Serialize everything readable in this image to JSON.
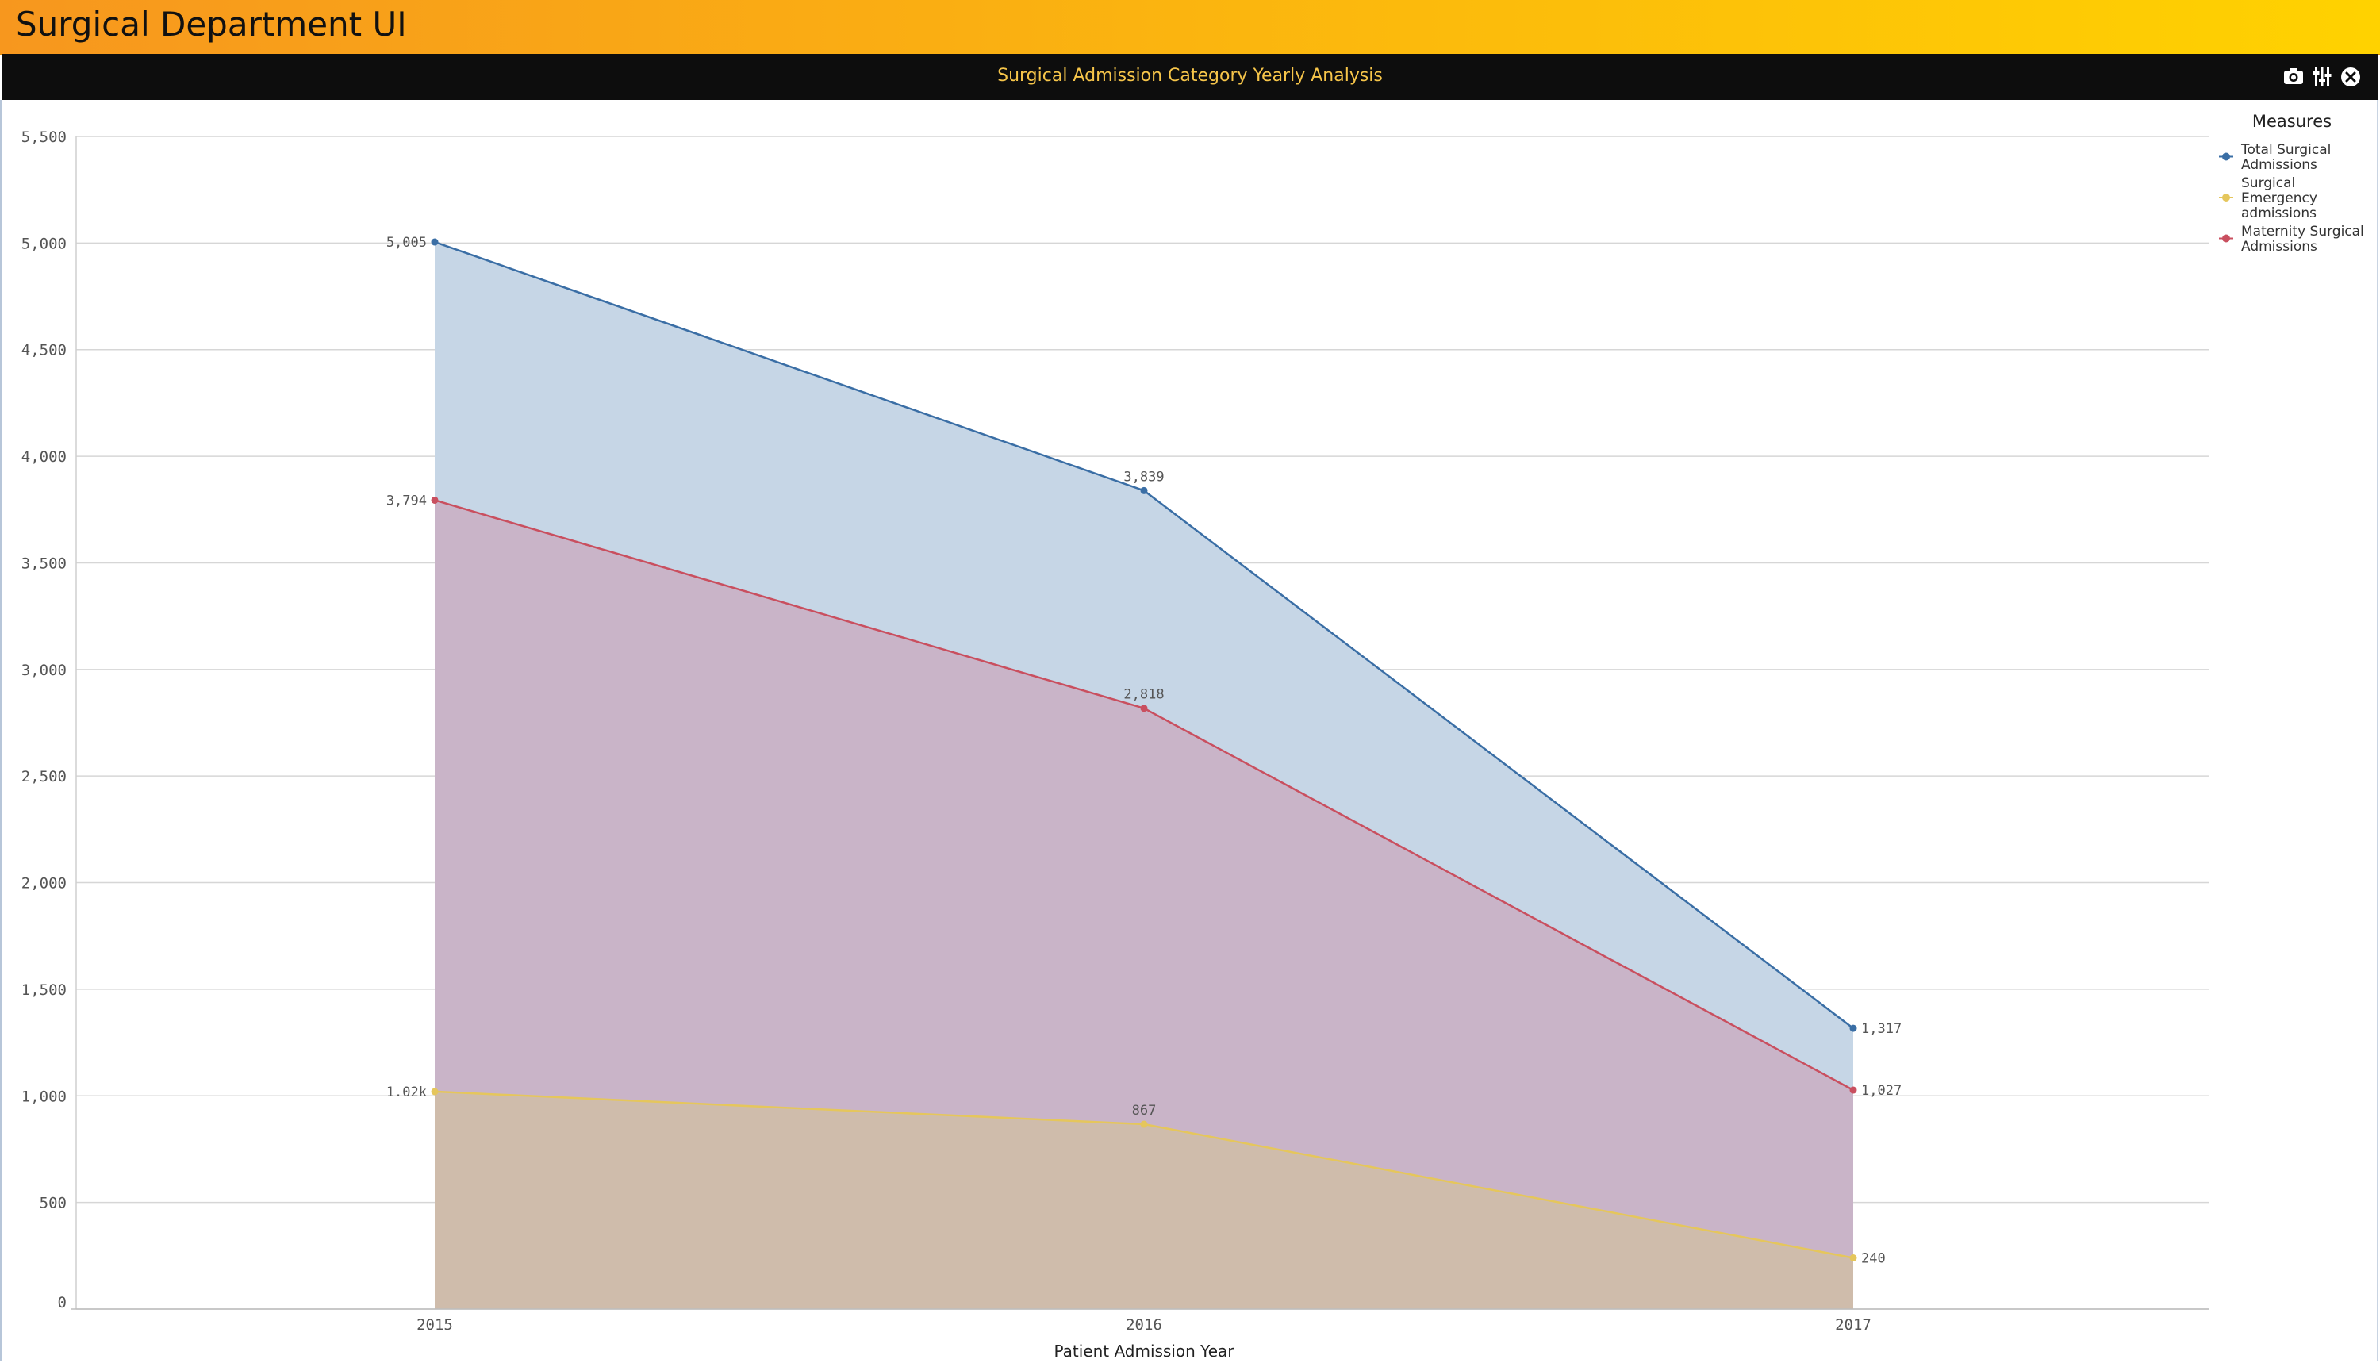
{
  "app": {
    "title": "Surgical Department UI"
  },
  "panel": {
    "title": "Surgical Admission Category Yearly Analysis",
    "icons": [
      "camera-icon",
      "settings-sliders-icon",
      "close-circle-icon"
    ]
  },
  "colors": {
    "header_gradient_start": "#f7971e",
    "header_gradient_end": "#ffd200",
    "panel_bar": "#0d0d0d",
    "panel_title": "#f6c54a"
  },
  "chart_data": {
    "type": "area",
    "x": [
      "2015",
      "2016",
      "2017"
    ],
    "xlabel": "Patient Admission Year",
    "ylabel": "",
    "ylim": [
      0,
      5500
    ],
    "yticks": [
      0,
      500,
      1000,
      1500,
      2000,
      2500,
      3000,
      3500,
      4000,
      4500,
      5000,
      5500
    ],
    "ytick_labels": [
      "0",
      "500",
      "1,000",
      "1,500",
      "2,000",
      "2,500",
      "3,000",
      "3,500",
      "4,000",
      "4,500",
      "5,000",
      "5,500"
    ],
    "grid": true,
    "legend_title": "Measures",
    "legend_position": "right",
    "series": [
      {
        "name": "Total Surgical Admissions",
        "legend_lines": [
          "Total Surgical",
          "Admissions"
        ],
        "values": [
          5005,
          3839,
          1317
        ],
        "labels": [
          "5,005",
          "3,839",
          "1,317"
        ],
        "color": "#3a6ea5",
        "fill": "#c6d6e6"
      },
      {
        "name": "Surgical Emergency admissions",
        "legend_lines": [
          "Surgical",
          "Emergency",
          "admissions"
        ],
        "values": [
          1020,
          867,
          240
        ],
        "labels": [
          "1.02k",
          "867",
          "240"
        ],
        "color": "#e5c65c",
        "fill": "#cfbcab"
      },
      {
        "name": "Maternity Surgical Admissions",
        "legend_lines": [
          "Maternity Surgical",
          "Admissions"
        ],
        "values": [
          3794,
          2818,
          1027
        ],
        "labels": [
          "3,794",
          "2,818",
          "1,027"
        ],
        "color": "#c94f5f",
        "fill": "#c9b4c8"
      }
    ]
  }
}
